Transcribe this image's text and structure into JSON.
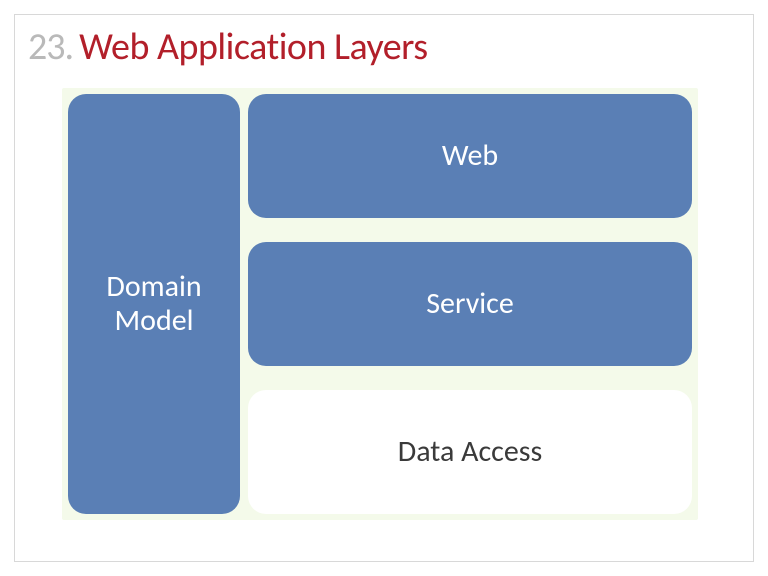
{
  "slide": {
    "number": "23.",
    "title": "Web Application Layers"
  },
  "layers": {
    "domain_model": "Domain\nModel",
    "web": "Web",
    "service": "Service",
    "data_access": "Data Access"
  },
  "colors": {
    "title": "#b21f2a",
    "number": "#b9b9b9",
    "block_blue": "#5a7fb5",
    "background": "#f4faea"
  }
}
